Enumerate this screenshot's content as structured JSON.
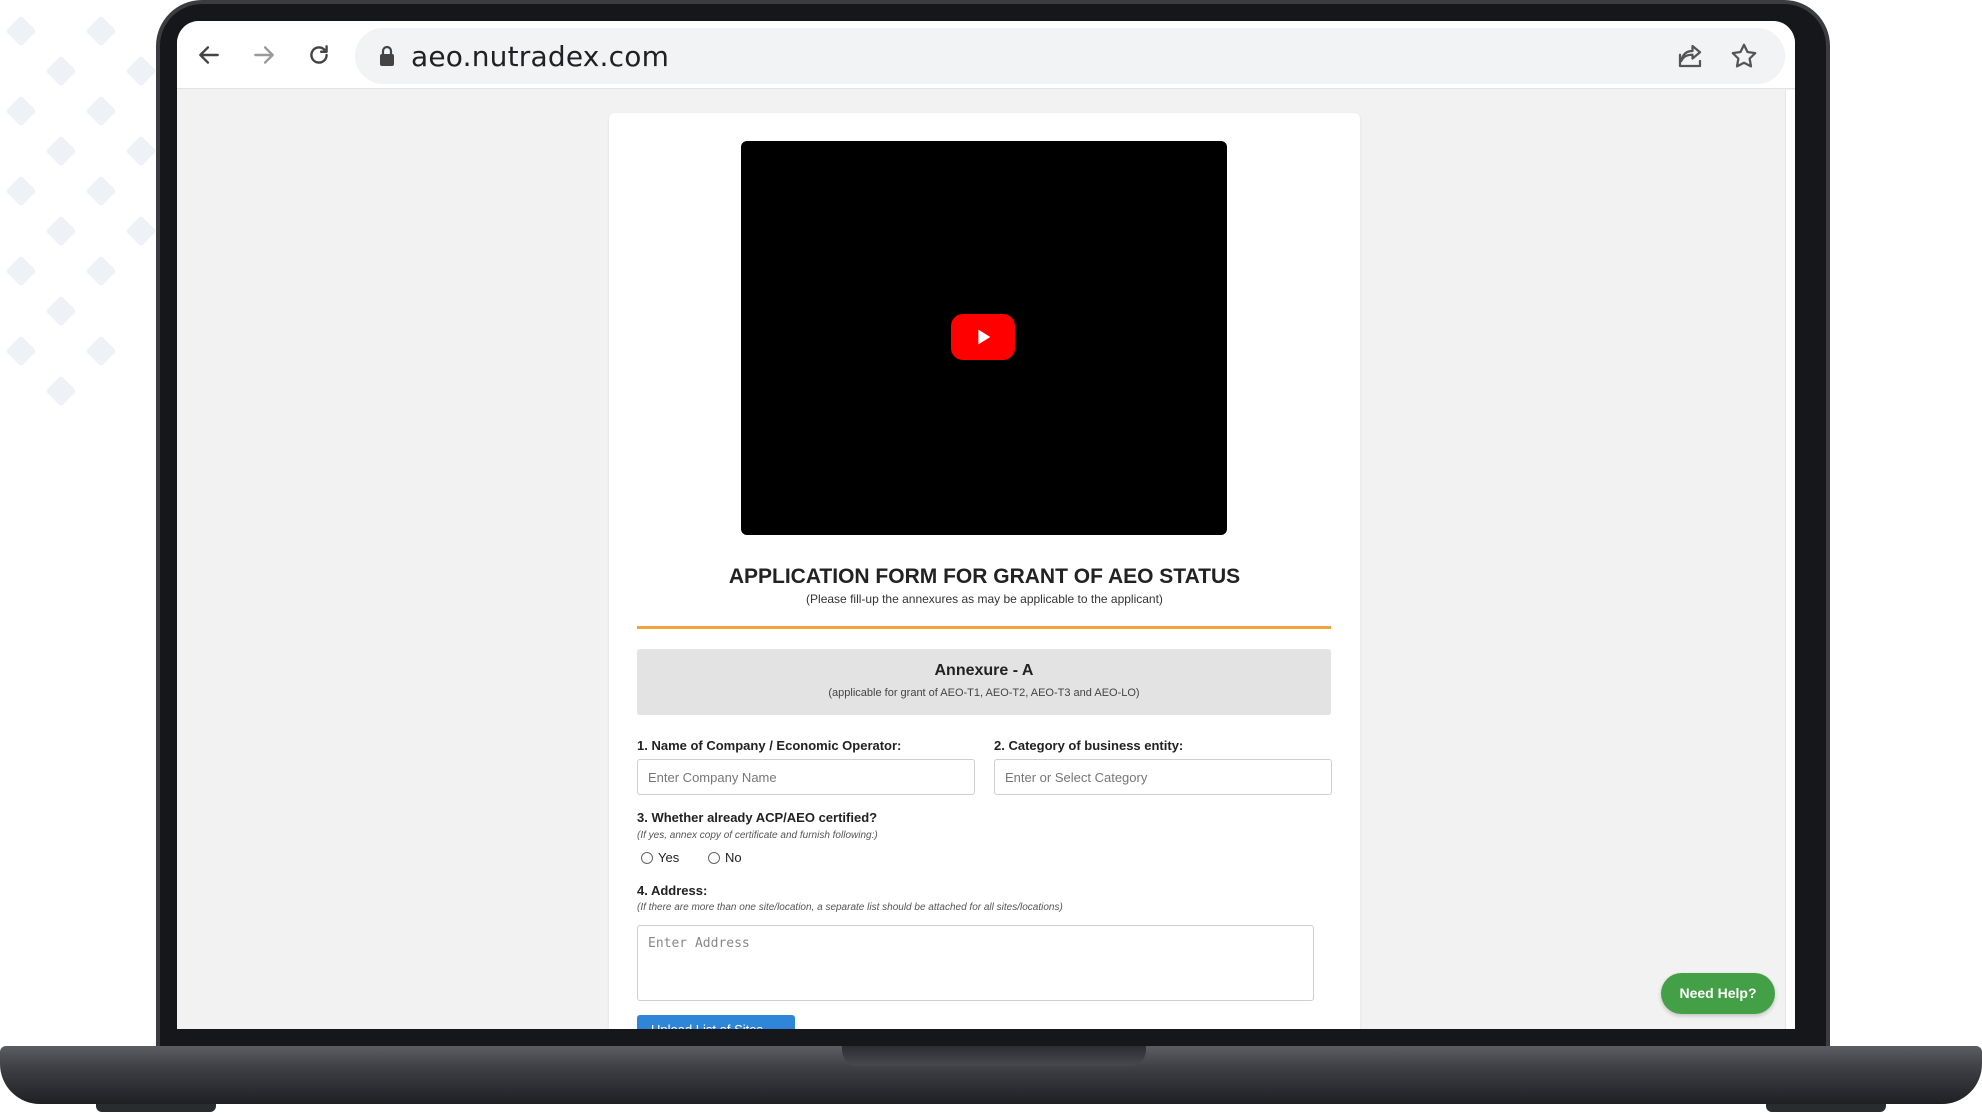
{
  "browser": {
    "url": "aeo.nutradex.com",
    "icons": [
      "back-arrow-icon",
      "forward-arrow-icon",
      "reload-icon",
      "lock-icon",
      "share-icon",
      "star-icon"
    ]
  },
  "video": {
    "play_icon": "youtube-play-icon"
  },
  "form": {
    "title": "APPLICATION FORM FOR GRANT OF AEO STATUS",
    "subtitle": "(Please fill-up the annexures as may be applicable to the applicant)",
    "annexure": {
      "title": "Annexure - A",
      "subtitle": "(applicable for grant of AEO-T1, AEO-T2, AEO-T3 and AEO-LO)"
    },
    "q1": {
      "label": "1. Name of Company / Economic Operator:",
      "placeholder": "Enter Company Name"
    },
    "q2": {
      "label": "2. Category of business entity:",
      "placeholder": "Enter or Select Category"
    },
    "q3": {
      "label": "3. Whether already ACP/AEO certified?",
      "note": "(If yes, annex copy of certificate and furnish following:)",
      "options": [
        "Yes",
        "No"
      ]
    },
    "q4": {
      "label": "4. Address:",
      "note": "(If there are more than one site/location, a separate list should be attached for all sites/locations)",
      "placeholder": "Enter Address"
    },
    "upload_label": "Upload List of Sites"
  },
  "help": {
    "label": "Need Help?"
  },
  "colors": {
    "accent_divider": "#f2a33a",
    "help_button": "#43a047",
    "upload_button": "#2f86d9",
    "youtube_red": "#ff0000"
  }
}
